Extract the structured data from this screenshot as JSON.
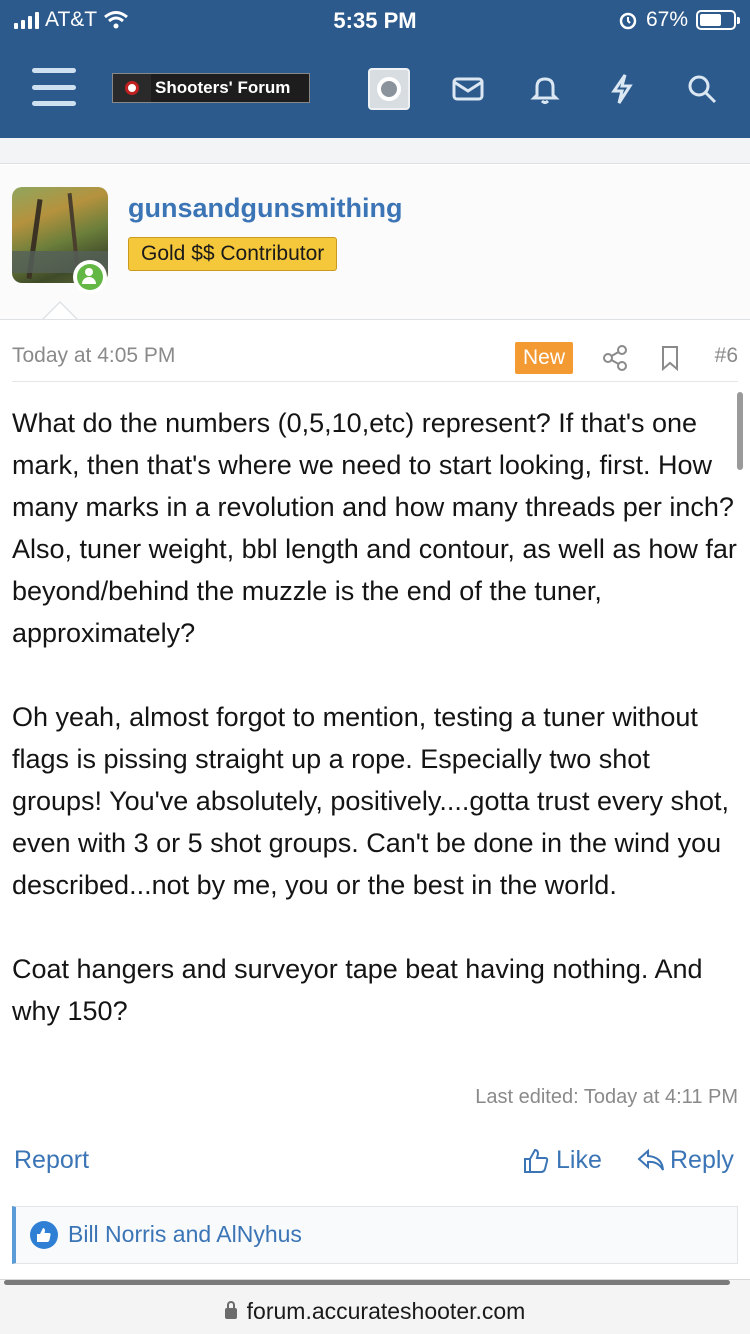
{
  "status_bar": {
    "carrier": "AT&T",
    "time": "5:35 PM",
    "battery_percent": "67%",
    "battery_level": 0.67
  },
  "header": {
    "logo_text": "Shooters' Forum",
    "icons": [
      "menu-icon",
      "avatar-icon",
      "inbox-icon",
      "bell-icon",
      "lightning-icon",
      "search-icon"
    ],
    "background_color": "#2d5a8c"
  },
  "user": {
    "name": "gunsandgunsmithing",
    "badge": "Gold $$ Contributor"
  },
  "post": {
    "date": "Today at 4:05 PM",
    "new_label": "New",
    "number": "#6",
    "paragraphs": [
      "What do the numbers (0,5,10,etc) represent? If that's one mark, then that's where we need to start looking, first. How many marks in a revolution and how many threads per inch? Also, tuner weight, bbl length and contour, as well as how far beyond/behind the muzzle is the end of the tuner, approximately?",
      "Oh yeah, almost forgot to mention, testing a tuner without flags is pissing straight up a rope. Especially two shot groups! You've absolutely, positively....gotta trust every shot, even with 3 or 5 shot groups. Can't be done in the wind you described...not by me, you or the best in the world.",
      "Coat hangers and surveyor tape beat having nothing. And why 150?"
    ],
    "last_edited": "Last edited: Today at 4:11 PM",
    "report_label": "Report",
    "like_label": "Like",
    "reply_label": "Reply",
    "reactions": "Bill Norris and AlNyhus"
  },
  "browser": {
    "url": "forum.accurateshooter.com"
  }
}
